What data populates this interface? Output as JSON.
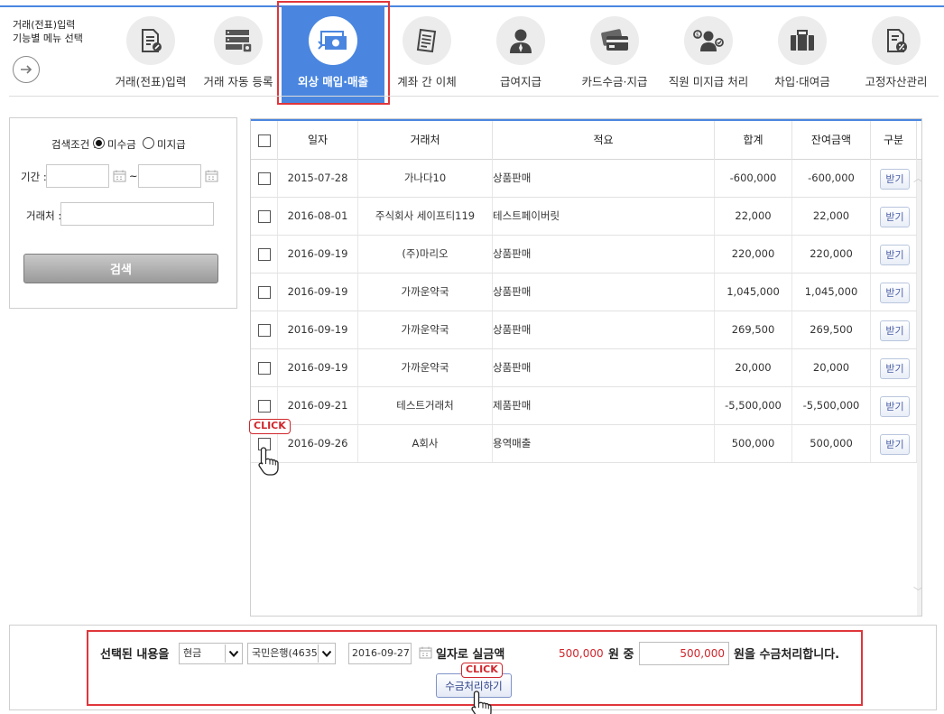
{
  "menu_caption_line1": "거래(전표)입력",
  "menu_caption_line2": "기능별 메뉴 선택",
  "menu": [
    {
      "label": "거래(전표)입력",
      "icon": "document-pen-icon"
    },
    {
      "label": "거래 자동 등록",
      "icon": "server-icon"
    },
    {
      "label": "외상 매입·매출",
      "icon": "money-transfer-icon",
      "active": true
    },
    {
      "label": "계좌 간 이체",
      "icon": "receipt-icon"
    },
    {
      "label": "급여지급",
      "icon": "person-icon"
    },
    {
      "label": "카드수금·지급",
      "icon": "credit-card-icon"
    },
    {
      "label": "직원 미지급 처리",
      "icon": "employee-icon"
    },
    {
      "label": "차입·대여금",
      "icon": "briefcase-icon"
    },
    {
      "label": "고정자산관리",
      "icon": "document-percent-icon"
    }
  ],
  "search": {
    "condition_label": "검색조건 :",
    "option_receivable": "미수금",
    "option_unpaid": "미지급",
    "selected_option": "미수금",
    "period_label": "기간 :",
    "period_sep": "~",
    "client_label": "거래처 :",
    "search_button": "검색"
  },
  "table": {
    "columns": [
      "일자",
      "거래처",
      "적요",
      "합계",
      "잔여금액",
      "구분"
    ],
    "rows": [
      {
        "date": "2015-07-28",
        "client": "가나다10",
        "memo": "상품판매",
        "total": "-600,000",
        "balance": "-600,000",
        "action": "받기",
        "checked": false
      },
      {
        "date": "2016-08-01",
        "client": "주식회사 세이프티119",
        "memo": "테스트페이버릿",
        "total": "22,000",
        "balance": "22,000",
        "action": "받기",
        "checked": false
      },
      {
        "date": "2016-09-19",
        "client": "(주)마리오",
        "memo": "상품판매",
        "total": "220,000",
        "balance": "220,000",
        "action": "받기",
        "checked": false
      },
      {
        "date": "2016-09-19",
        "client": "가까운약국",
        "memo": "상품판매",
        "total": "1,045,000",
        "balance": "1,045,000",
        "action": "받기",
        "checked": false
      },
      {
        "date": "2016-09-19",
        "client": "가까운약국",
        "memo": "상품판매",
        "total": "269,500",
        "balance": "269,500",
        "action": "받기",
        "checked": false
      },
      {
        "date": "2016-09-19",
        "client": "가까운약국",
        "memo": "상품판매",
        "total": "20,000",
        "balance": "20,000",
        "action": "받기",
        "checked": false
      },
      {
        "date": "2016-09-21",
        "client": "테스트거래처",
        "memo": "제품판매",
        "total": "-5,500,000",
        "balance": "-5,500,000",
        "action": "받기",
        "checked": false
      },
      {
        "date": "2016-09-26",
        "client": "A회사",
        "memo": "용역매출",
        "total": "500,000",
        "balance": "500,000",
        "action": "받기",
        "checked": true
      }
    ]
  },
  "bottom": {
    "selected_text": "선택된 내용을",
    "payment_method": "현금",
    "bank_account": "국민은행(4635",
    "date_value": "2016-09-27",
    "date_suffix": "일자로 실금액",
    "amount": "500,000",
    "amount_mid": "원 중",
    "input_amount": "500,000",
    "amount_suffix": "원을 수금처리합니다.",
    "process_button": "수금처리하기"
  },
  "annotations": {
    "click_1": "CLICK",
    "click_2": "CLICK"
  },
  "colors": {
    "accent": "#4a86e0",
    "highlight_frame": "#e0363b",
    "amount_red": "#d0262c"
  }
}
